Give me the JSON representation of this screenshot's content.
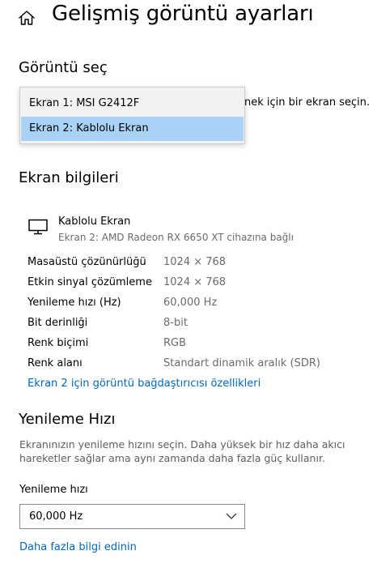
{
  "header": {
    "title": "Gelişmiş görüntü ayarları"
  },
  "select_display": {
    "heading": "Görüntü seç",
    "behind_text": "nek için bir ekran seçin.",
    "options": [
      {
        "label": "Ekran 1: MSI G2412F"
      },
      {
        "label": "Ekran 2: Kablolu Ekran",
        "selected": true
      }
    ]
  },
  "display_info": {
    "heading": "Ekran bilgileri",
    "device_name": "Kablolu Ekran",
    "device_sub": "Ekran 2: AMD Radeon RX 6650 XT cihazına bağlı",
    "rows": [
      {
        "label": "Masaüstü çözünürlüğü",
        "value": "1024 × 768"
      },
      {
        "label": "Etkin sinyal çözümleme",
        "value": "1024 × 768"
      },
      {
        "label": "Yenileme hızı (Hz)",
        "value": "60,000 Hz"
      },
      {
        "label": "Bit derinliği",
        "value": "8-bit"
      },
      {
        "label": "Renk biçimi",
        "value": "RGB"
      },
      {
        "label": "Renk alanı",
        "value": "Standart dinamik aralık (SDR)"
      }
    ],
    "adapter_link": "Ekran 2 için görüntü bağdaştırıcısı özellikleri"
  },
  "refresh_rate": {
    "heading": "Yenileme Hızı",
    "description": "Ekranınızın yenileme hızını seçin. Daha yüksek bir hız daha akıcı hareketler sağlar ama aynı zamanda daha fazla güç kullanır.",
    "field_label": "Yenileme hızı",
    "selected_value": "60,000 Hz",
    "more_info_link": "Daha fazla bilgi edinin"
  },
  "colors": {
    "link": "#0067c0",
    "selected_option_bg": "#a8d3f6",
    "secondary_text": "#6b6b6b"
  },
  "icons": [
    "home-icon",
    "monitor-icon",
    "chevron-down-icon"
  ]
}
